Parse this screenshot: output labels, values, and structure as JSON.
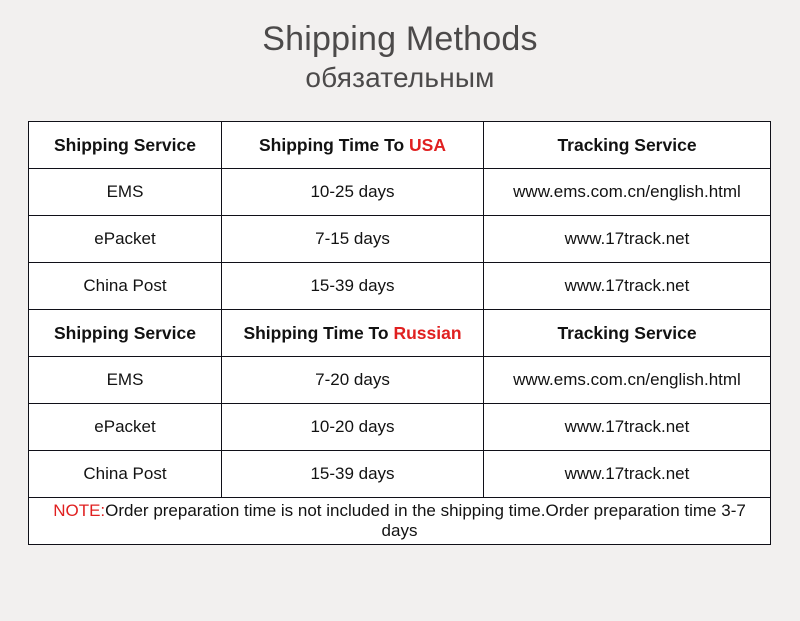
{
  "title": {
    "main": "Shipping Methods",
    "sub": "обязательным"
  },
  "colors": {
    "accent_red": "#e02020",
    "text_dark": "#121212",
    "title_gray": "#4c4a4a",
    "page_background": "#f2f0ef",
    "table_background": "#ffffff",
    "border": "#101018"
  },
  "table": {
    "sections": [
      {
        "header": {
          "service": "Shipping Service",
          "time_prefix": "Shipping Time To ",
          "time_destination": "USA",
          "tracking": "Tracking Service"
        },
        "rows": [
          {
            "service": "EMS",
            "time": "10-25 days",
            "tracking": "www.ems.com.cn/english.html"
          },
          {
            "service": "ePacket",
            "time": "7-15 days",
            "tracking": "www.17track.net"
          },
          {
            "service": "China Post",
            "time": "15-39 days",
            "tracking": "www.17track.net"
          }
        ]
      },
      {
        "header": {
          "service": "Shipping Service",
          "time_prefix": "Shipping Time To ",
          "time_destination": "Russian",
          "tracking": "Tracking Service"
        },
        "rows": [
          {
            "service": "EMS",
            "time": "7-20 days",
            "tracking": "www.ems.com.cn/english.html"
          },
          {
            "service": "ePacket",
            "time": "10-20 days",
            "tracking": "www.17track.net"
          },
          {
            "service": "China Post",
            "time": "15-39 days",
            "tracking": "www.17track.net"
          }
        ]
      }
    ],
    "note": {
      "label": "NOTE:",
      "text": "Order preparation time is not included in the shipping time.Order preparation time 3-7 days"
    }
  }
}
